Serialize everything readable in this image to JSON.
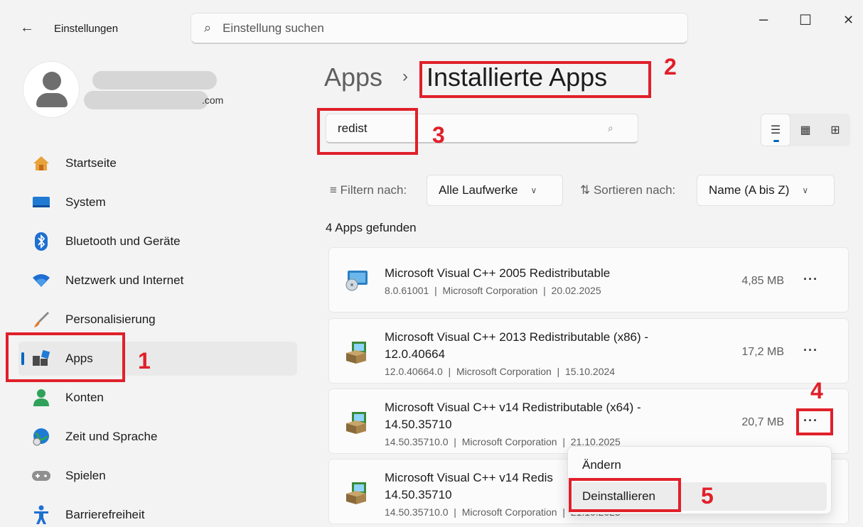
{
  "titlebar": {
    "back_glyph": "←",
    "title": "Einstellungen",
    "search_placeholder": "Einstellung suchen",
    "minimize": "–",
    "maximize": "☐",
    "close": "✕"
  },
  "profile": {
    "email_suffix": ".com"
  },
  "sidebar": {
    "items": [
      {
        "label": "Startseite",
        "icon": "home-icon"
      },
      {
        "label": "System",
        "icon": "monitor-icon"
      },
      {
        "label": "Bluetooth und Geräte",
        "icon": "bluetooth-icon"
      },
      {
        "label": "Netzwerk und Internet",
        "icon": "wifi-icon"
      },
      {
        "label": "Personalisierung",
        "icon": "brush-icon"
      },
      {
        "label": "Apps",
        "icon": "apps-icon",
        "active": true
      },
      {
        "label": "Konten",
        "icon": "person-icon"
      },
      {
        "label": "Zeit und Sprache",
        "icon": "globe-clock-icon"
      },
      {
        "label": "Spielen",
        "icon": "gamepad-icon"
      },
      {
        "label": "Barrierefreiheit",
        "icon": "accessibility-icon"
      }
    ]
  },
  "main": {
    "breadcrumb_parent": "Apps",
    "breadcrumb_sep": "›",
    "breadcrumb_current": "Installierte Apps",
    "search_value": "redist",
    "filter_label": "Filtern nach:",
    "filter_value": "Alle Laufwerke",
    "sort_label": "Sortieren nach:",
    "sort_value": "Name (A bis Z)",
    "found_text": "4 Apps gefunden",
    "more_glyph": "···",
    "apps": [
      {
        "name": "Microsoft Visual C++ 2005 Redistributable",
        "version": "8.0.61001",
        "publisher": "Microsoft Corporation",
        "date": "20.02.2025",
        "size": "4,85 MB"
      },
      {
        "name": "Microsoft Visual C++ 2013 Redistributable (x86) - 12.0.40664",
        "version": "12.0.40664.0",
        "publisher": "Microsoft Corporation",
        "date": "15.10.2024",
        "size": "17,2 MB"
      },
      {
        "name": "Microsoft Visual C++ v14 Redistributable (x64) - 14.50.35710",
        "version": "14.50.35710.0",
        "publisher": "Microsoft Corporation",
        "date": "21.10.2025",
        "size": "20,7 MB"
      },
      {
        "name": "Microsoft Visual C++ v14 Redis",
        "name_line2": "14.50.35710",
        "version": "14.50.35710.0",
        "publisher": "Microsoft Corporation",
        "date": "21.10.2025",
        "size": ""
      }
    ]
  },
  "context_menu": {
    "items": [
      "Ändern",
      "Deinstallieren"
    ]
  },
  "annotations": {
    "color": "#e0202a",
    "numbers": [
      "1",
      "2",
      "3",
      "4",
      "5"
    ]
  }
}
